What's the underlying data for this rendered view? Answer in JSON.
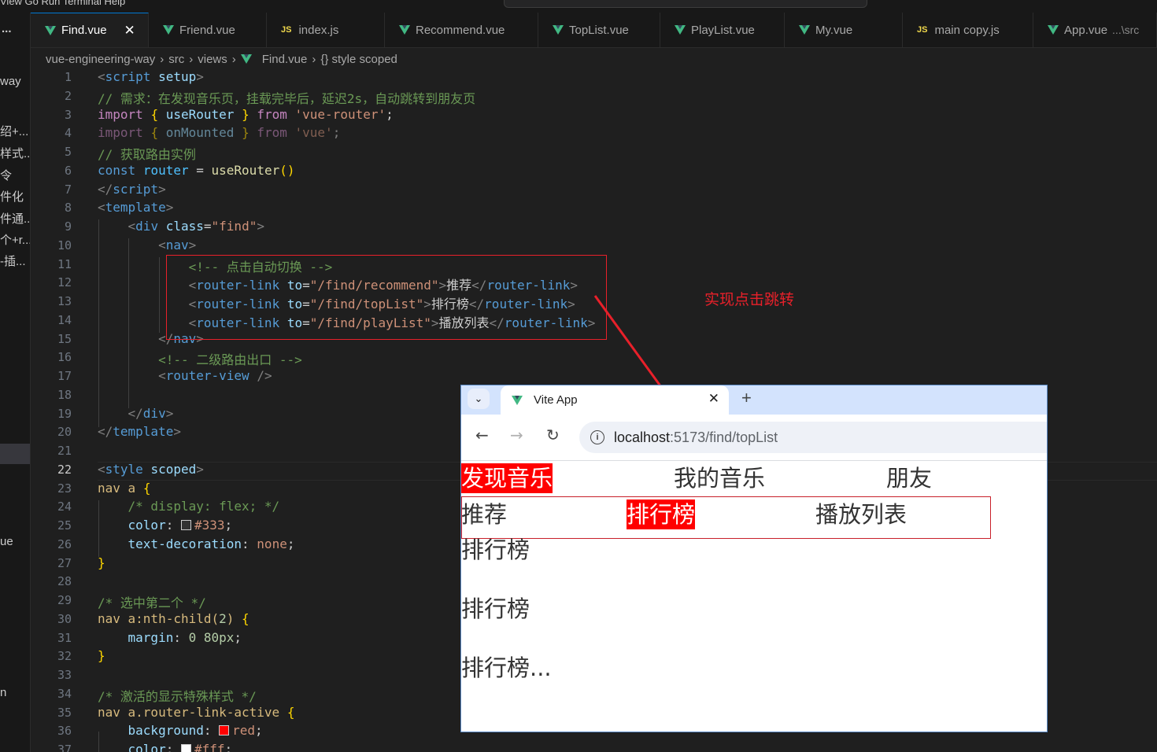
{
  "window": {
    "menu_fragment": "View   Go   Run   Terminal   Help"
  },
  "explorer": {
    "more_label": "...",
    "items": [
      "way",
      "绍+...",
      "样式...",
      "令",
      "件化",
      "件通...",
      "个+r...",
      "-插...",
      "ue",
      "n"
    ]
  },
  "tabs": [
    {
      "label": "Find.vue",
      "icon": "vue-icon",
      "active": true
    },
    {
      "label": "Friend.vue",
      "icon": "vue-icon"
    },
    {
      "label": "index.js",
      "icon": "js-icon"
    },
    {
      "label": "Recommend.vue",
      "icon": "vue-icon"
    },
    {
      "label": "TopList.vue",
      "icon": "vue-icon"
    },
    {
      "label": "PlayList.vue",
      "icon": "vue-icon"
    },
    {
      "label": "My.vue",
      "icon": "vue-icon"
    },
    {
      "label": "main copy.js",
      "icon": "js-icon"
    },
    {
      "label": "App.vue",
      "icon": "vue-icon",
      "description": "...\\src"
    }
  ],
  "tab_close": "✕",
  "breadcrumb": [
    "vue-engineering-way",
    "src",
    "views",
    "Find.vue",
    "{} style scoped"
  ],
  "editor": {
    "current_line": 22,
    "line_numbers": [
      "1",
      "2",
      "3",
      "4",
      "5",
      "6",
      "7",
      "8",
      "9",
      "10",
      "11",
      "12",
      "13",
      "14",
      "15",
      "16",
      "17",
      "18",
      "19",
      "20",
      "21",
      "22",
      "23",
      "24",
      "25",
      "26",
      "27",
      "28",
      "29",
      "30",
      "31",
      "32",
      "33",
      "34",
      "35",
      "36",
      "37"
    ]
  },
  "annotation": {
    "label": "实现点击跳转",
    "color": "#e8202a"
  },
  "browser": {
    "tab_title": "Vite App",
    "tab_close": "✕",
    "new_tab": "+",
    "tab_list": "⌄",
    "back": "←",
    "forward": "→",
    "reload": "↻",
    "info": "i",
    "url_host": "localhost",
    "url_rest": ":5173/find/topList",
    "top_nav": [
      "发现音乐",
      "我的音乐",
      "朋友"
    ],
    "sub_nav": [
      "推荐",
      "排行榜",
      "播放列表"
    ],
    "content": [
      "排行榜",
      "排行榜",
      "排行榜..."
    ],
    "active_color": "#ff0000"
  }
}
